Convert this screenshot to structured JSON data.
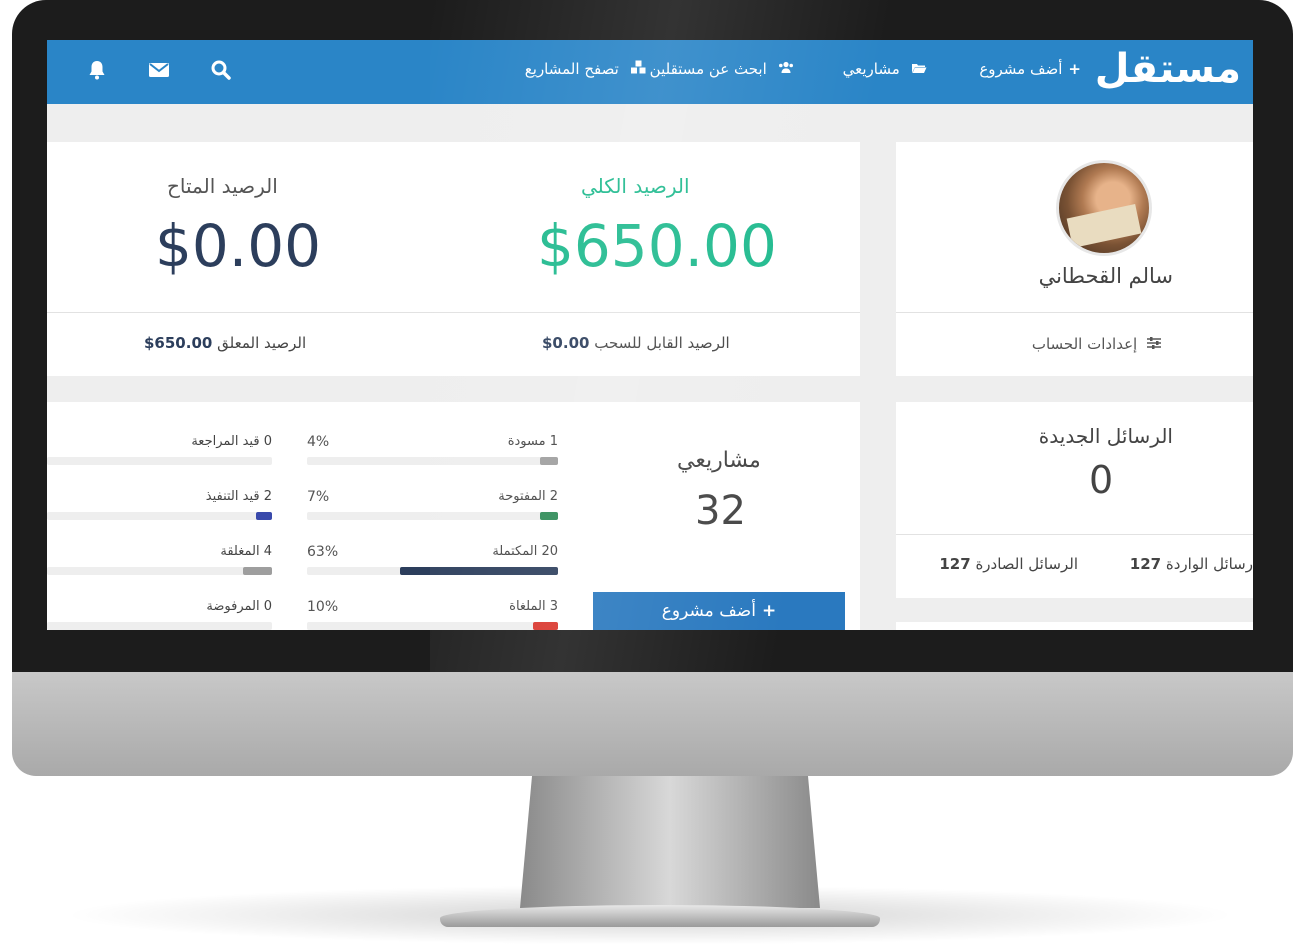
{
  "brand": {
    "logo": "مستقل",
    "primary_color": "#2a85c7"
  },
  "navbar": {
    "add_project": "أضف مشروع",
    "my_projects": "مشاريعي",
    "find_freelancers": "ابحث عن مستقلين",
    "browse_projects": "تصفح المشاريع",
    "icons": [
      "search-icon",
      "mail-icon",
      "bell-icon"
    ]
  },
  "profile": {
    "name": "سالم القحطاني",
    "account_settings": "إعدادات الحساب"
  },
  "balance": {
    "total_label": "الرصيد الكلي",
    "total_value": "$650.00",
    "available_label": "الرصيد المتاح",
    "available_value": "$0.00",
    "withdrawable_label": "الرصيد القابل للسحب",
    "withdrawable_value": "$0.00",
    "pending_label": "الرصيد المعلق",
    "pending_value": "$650.00",
    "total_color": "#1fba8e"
  },
  "messages": {
    "title": "الرسائل الجديدة",
    "count": "0",
    "outgoing_label": "الرسائل الصادرة",
    "outgoing_value": "127",
    "incoming_label": "رسائل الواردة",
    "incoming_value": "127"
  },
  "projects": {
    "title": "مشاريعي",
    "count": "32",
    "add_button": "أضف مشروع",
    "stats_right": [
      {
        "label": "1 مسودة",
        "percent": "4%",
        "fraction": 0.04,
        "color": "#9e9e9e"
      },
      {
        "label": "2 المفتوحة",
        "percent": "7%",
        "fraction": 0.07,
        "color": "#2e8b57"
      },
      {
        "label": "20 المكتملة",
        "percent": "63%",
        "fraction": 0.63,
        "color": "#2c3e5c"
      },
      {
        "label": "3 الملغاة",
        "percent": "10%",
        "fraction": 0.1,
        "color": "#d9342b"
      }
    ],
    "stats_left": [
      {
        "label": "0 قيد المراجعة",
        "fraction": 0.0,
        "color": "#9e9e9e"
      },
      {
        "label": "2 قيد التنفيذ",
        "fraction": 0.07,
        "color": "#3949ab"
      },
      {
        "label": "4 المغلقة",
        "fraction": 0.13,
        "color": "#9e9e9e"
      },
      {
        "label": "0 المرفوضة",
        "fraction": 0.0,
        "color": "#9e9e9e"
      }
    ]
  }
}
